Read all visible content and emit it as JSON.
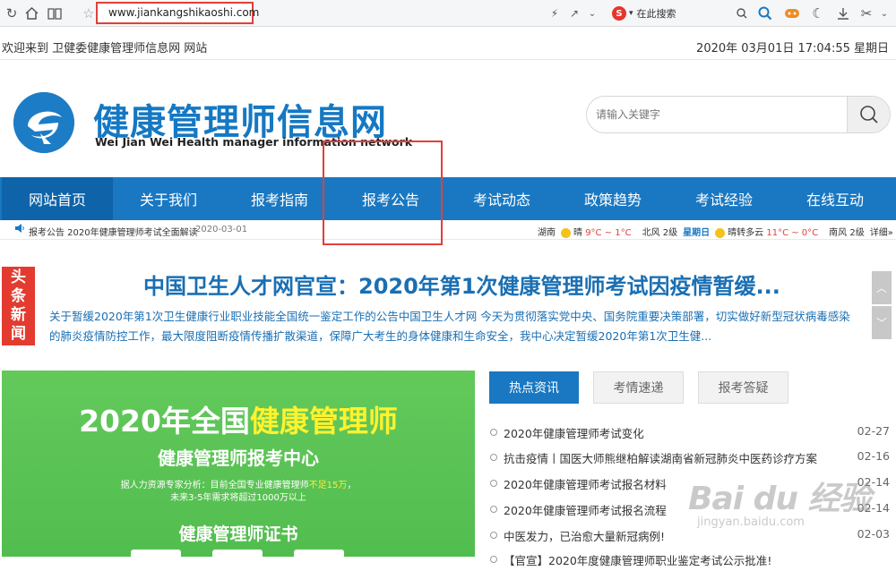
{
  "browser": {
    "url": "www.jiankangshikaoshi.com",
    "search_engine_label": "在此搜索"
  },
  "top_info": {
    "welcome": "欢迎来到 卫健委健康管理师信息网 网站",
    "datetime": "2020年 03月01日   17:04:55   星期日"
  },
  "header": {
    "title": "健康管理师信息网",
    "subtitle": "Wei Jian Wei Health manager information network",
    "search_placeholder": "请输入关键字"
  },
  "nav": {
    "items": [
      {
        "label": "网站首页"
      },
      {
        "label": "关于我们"
      },
      {
        "label": "报考指南"
      },
      {
        "label": "报考公告"
      },
      {
        "label": "考试动态"
      },
      {
        "label": "政策趋势"
      },
      {
        "label": "考试经验"
      },
      {
        "label": "在线互动"
      }
    ]
  },
  "notice": {
    "text": "报考公告 2020年健康管理师考试全面解读",
    "date": "2020-03-01"
  },
  "weather": {
    "city": "湖南",
    "today_cond": "晴",
    "today_temp": "9°C ~ 1°C",
    "today_wind": "北风 2级",
    "today_label": "星期日",
    "tomorrow_cond": "晴转多云",
    "tomorrow_temp": "11°C ~ 0°C",
    "tomorrow_wind": "南风 2级",
    "more": "详细»"
  },
  "headline": {
    "badge": "头条新闻",
    "title": "中国卫生人才网官宣：2020年第1次健康管理师考试因疫情暂缓...",
    "description": "关于暂缓2020年第1次卫生健康行业职业技能全国统一鉴定工作的公告中国卫生人才网 今天为贯彻落实党中央、国务院重要决策部署，切实做好新型冠状病毒感染的肺炎疫情防控工作，最大限度阻断疫情传播扩散渠道，保障广大考生的身体健康和生命安全，我中心决定暂缓2020年第1次卫生健..."
  },
  "banner": {
    "title_prefix": "2020年全国",
    "title_highlight": "健康管理师",
    "subtitle": "健康管理师报考中心",
    "analysis_prefix": "据人力资源专家分析：目前全国专业健康管理师",
    "analysis_highlight": "不足15万",
    "analysis_suffix": "，",
    "analysis_line2": "未来3-5年需求将超过1000万以上",
    "cert": "健康管理师证书"
  },
  "tabs": [
    {
      "label": "热点资讯"
    },
    {
      "label": "考情速递"
    },
    {
      "label": "报考答疑"
    }
  ],
  "news": [
    {
      "title": "2020年健康管理师考试变化",
      "date": "02-27"
    },
    {
      "title": "抗击疫情丨国医大师熊继柏解读湖南省新冠肺炎中医药诊疗方案",
      "date": "02-16"
    },
    {
      "title": "2020年健康管理师考试报名材料",
      "date": "02-14"
    },
    {
      "title": "2020年健康管理师考试报名流程",
      "date": "02-14"
    },
    {
      "title": "中医发力，已治愈大量新冠病例!",
      "date": "02-03"
    },
    {
      "title": "【官宣】2020年度健康管理师职业鉴定考试公示批准!",
      "date": ""
    }
  ],
  "watermark": {
    "main": "Bai du 经验",
    "url": "jingyan.baidu.com"
  },
  "colors": {
    "primary": "#1a78c2",
    "nav_active": "#0f63a8",
    "headline_red": "#e33b2f",
    "banner_green": "#5bc455",
    "highlight_box": "#e0403a"
  }
}
